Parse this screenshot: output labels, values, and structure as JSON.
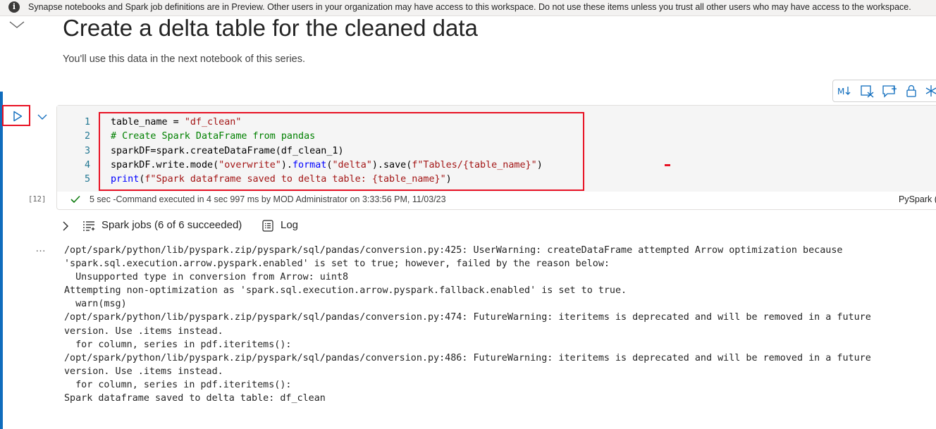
{
  "banner": {
    "text": "Synapse notebooks and Spark job definitions are in Preview. Other users in your organization may have access to this workspace. Do not use these items unless you trust all other users who may have access to the workspace."
  },
  "markdown_cell": {
    "title": "Create a delta table for the cleaned data",
    "paragraph": "You'll use this data in the next notebook of this series."
  },
  "cell_toolbar": {
    "buttons": [
      "markdown-toggle-icon",
      "clear-output-icon",
      "comment-icon",
      "lock-icon",
      "freeze-icon"
    ]
  },
  "code_cell": {
    "execution_count": "[12]",
    "lines": [
      {
        "no": "1",
        "tokens": [
          {
            "t": "table_name = ",
            "c": "plain"
          },
          {
            "t": "\"df_clean\"",
            "c": "str"
          }
        ]
      },
      {
        "no": "2",
        "tokens": [
          {
            "t": "# Create Spark DataFrame from pandas",
            "c": "cmt"
          }
        ]
      },
      {
        "no": "3",
        "tokens": [
          {
            "t": "sparkDF=spark.createDataFrame(df_clean_1)",
            "c": "plain"
          }
        ]
      },
      {
        "no": "4",
        "tokens": [
          {
            "t": "sparkDF.write.mode(",
            "c": "plain"
          },
          {
            "t": "\"overwrite\"",
            "c": "str"
          },
          {
            "t": ").",
            "c": "plain"
          },
          {
            "t": "format",
            "c": "fn"
          },
          {
            "t": "(",
            "c": "plain"
          },
          {
            "t": "\"delta\"",
            "c": "str"
          },
          {
            "t": ").save(",
            "c": "plain"
          },
          {
            "t": "f\"Tables/{table_name}\"",
            "c": "str"
          },
          {
            "t": ")",
            "c": "plain"
          }
        ]
      },
      {
        "no": "5",
        "tokens": [
          {
            "t": "print",
            "c": "fn"
          },
          {
            "t": "(",
            "c": "plain"
          },
          {
            "t": "f\"Spark dataframe saved to delta table: {table_name}\"",
            "c": "str"
          },
          {
            "t": ")",
            "c": "plain"
          }
        ]
      }
    ],
    "status": "5 sec -Command executed in 4 sec 997 ms by MOD Administrator on 3:33:56 PM, 11/03/23",
    "language": "PySpark (Python)"
  },
  "output_toolbar": {
    "spark_jobs": "Spark jobs (6 of 6 succeeded)",
    "log": "Log"
  },
  "output": {
    "more": "…",
    "text": "/opt/spark/python/lib/pyspark.zip/pyspark/sql/pandas/conversion.py:425: UserWarning: createDataFrame attempted Arrow optimization because\n'spark.sql.execution.arrow.pyspark.enabled' is set to true; however, failed by the reason below:\n  Unsupported type in conversion from Arrow: uint8\nAttempting non-optimization as 'spark.sql.execution.arrow.pyspark.fallback.enabled' is set to true.\n  warn(msg)\n/opt/spark/python/lib/pyspark.zip/pyspark/sql/pandas/conversion.py:474: FutureWarning: iteritems is deprecated and will be removed in a future\nversion. Use .items instead.\n  for column, series in pdf.iteritems():\n/opt/spark/python/lib/pyspark.zip/pyspark/sql/pandas/conversion.py:486: FutureWarning: iteritems is deprecated and will be removed in a future\nversion. Use .items instead.\n  for column, series in pdf.iteritems():\nSpark dataframe saved to delta table: df_clean"
  },
  "colors": {
    "accent": "#0f6cbd",
    "highlight_red": "#e81123",
    "success_green": "#107c10",
    "string": "#a31515",
    "comment": "#008000",
    "keyword": "#0000ff"
  }
}
